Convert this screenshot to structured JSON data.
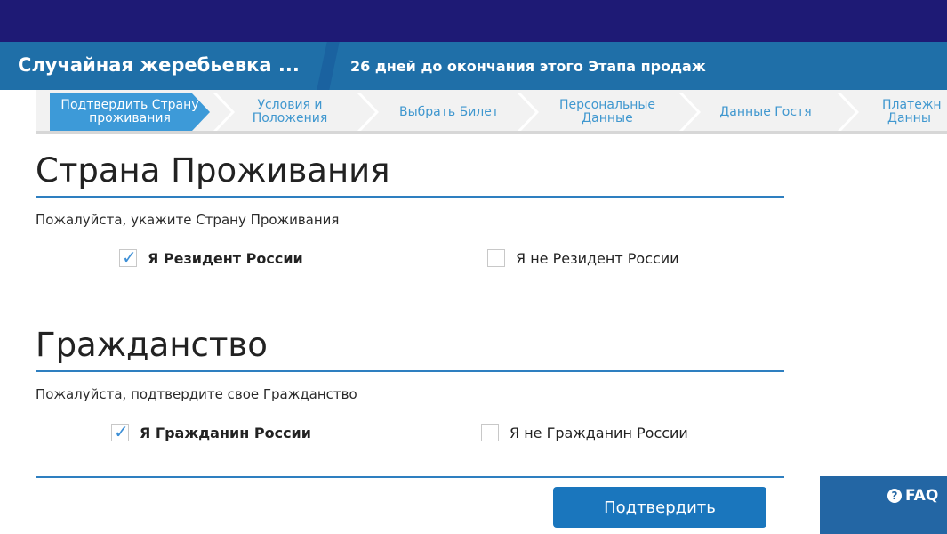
{
  "header": {
    "title": "Случайная жеребьевка ...",
    "countdown": "26 дней до окончания этого Этапа продаж"
  },
  "steps": [
    {
      "label_line1": "Подтвердить Страну",
      "label_line2": "проживания",
      "active": true
    },
    {
      "label_line1": "Условия и",
      "label_line2": "Положения",
      "active": false
    },
    {
      "label_line1": "Выбрать Билет",
      "label_line2": "",
      "active": false
    },
    {
      "label_line1": "Персональные",
      "label_line2": "Данные",
      "active": false
    },
    {
      "label_line1": "Данные Гостя",
      "label_line2": "",
      "active": false
    },
    {
      "label_line1": "Платежн",
      "label_line2": "Данны",
      "active": false
    }
  ],
  "residence": {
    "title": "Страна Проживания",
    "subtitle": "Пожалуйста, укажите Страну Проживания",
    "option_yes": "Я Резидент России",
    "option_no": "Я не Резидент России",
    "yes_checked": true,
    "no_checked": false
  },
  "citizenship": {
    "title": "Гражданство",
    "subtitle": "Пожалуйста, подтвердите свое Гражданство",
    "option_yes": "Я Гражданин России",
    "option_no": "Я не Гражданин России",
    "yes_checked": true,
    "no_checked": false
  },
  "actions": {
    "confirm_label": "Подтвердить"
  },
  "faq": {
    "label": "FAQ",
    "icon_glyph": "?"
  },
  "icons": {
    "check": "✓"
  },
  "colors": {
    "top_bar": "#1e1a75",
    "header": "#1f6fa8",
    "active_step": "#3d9ad8",
    "accent": "#1a76bd"
  }
}
